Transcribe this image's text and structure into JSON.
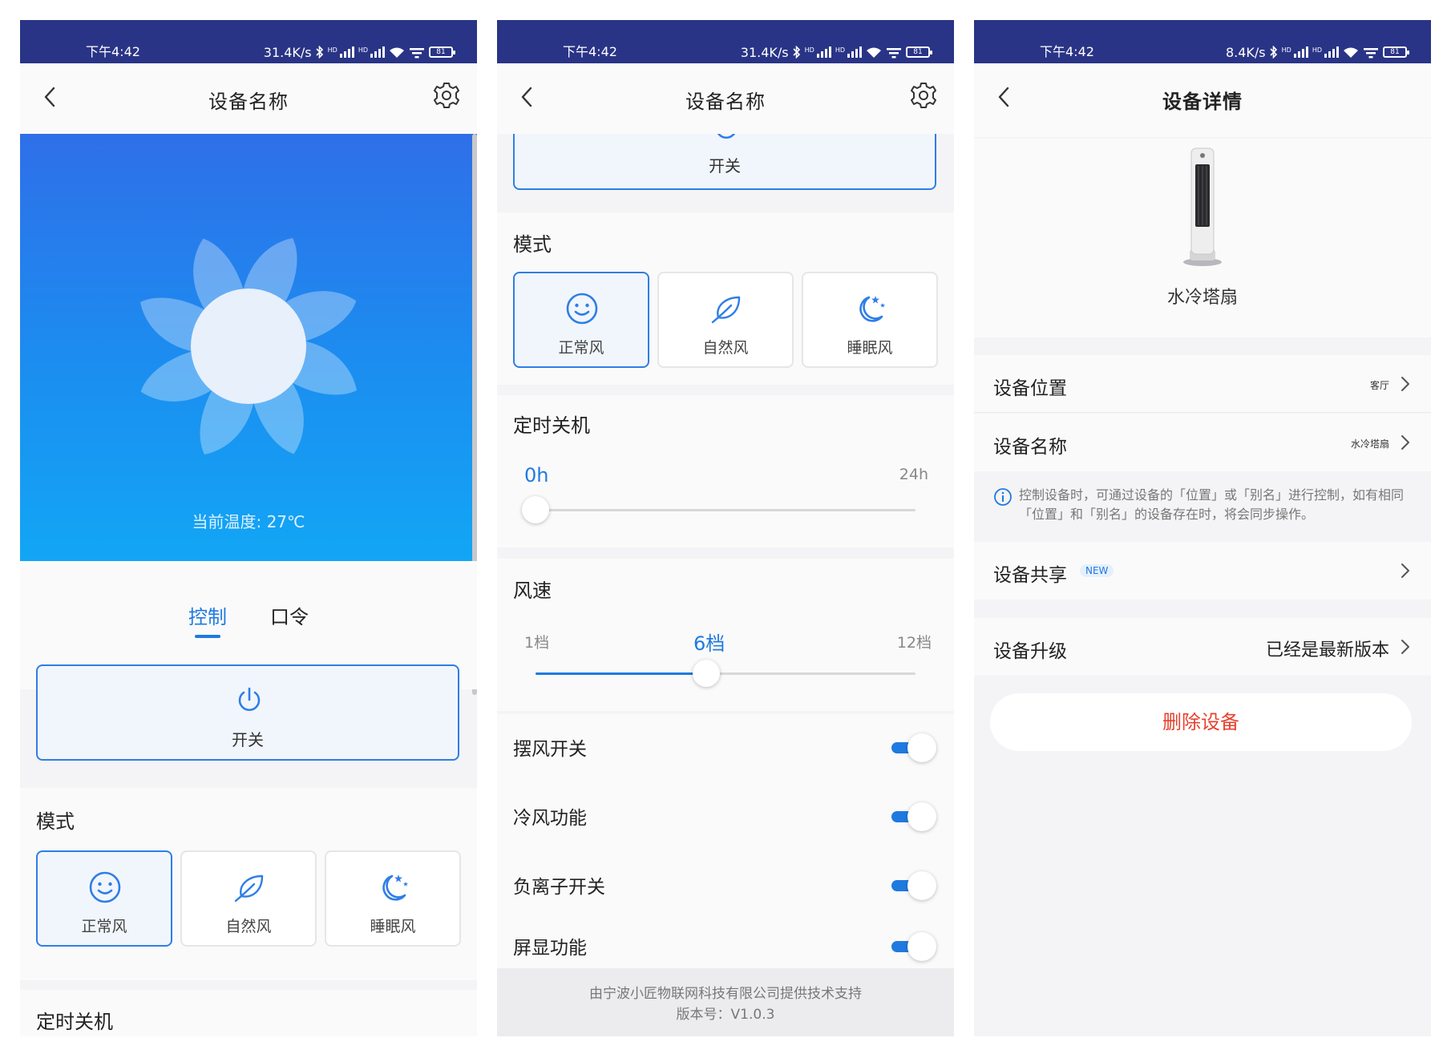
{
  "colors": {
    "status_bar": "#2a3486",
    "accent": "#1f7ae0",
    "delete": "#e8412f"
  },
  "status_bars": [
    {
      "time": "下午4:42",
      "speed": "31.4K/s",
      "battery": "81"
    },
    {
      "time": "下午4:42",
      "speed": "31.4K/s",
      "battery": "81"
    },
    {
      "time": "下午4:42",
      "speed": "8.4K/s",
      "battery": "81"
    }
  ],
  "screen1": {
    "title": "设备名称",
    "temperature": "当前温度: 27℃",
    "tabs": [
      "控制",
      "口令"
    ],
    "active_tab": "控制",
    "power_label": "开关",
    "mode_title": "模式",
    "modes": [
      {
        "label": "正常风",
        "icon": "smile-icon",
        "active": true
      },
      {
        "label": "自然风",
        "icon": "leaf-icon",
        "active": false
      },
      {
        "label": "睡眠风",
        "icon": "moon-stars-icon",
        "active": false
      }
    ],
    "timer_title": "定时关机"
  },
  "screen2": {
    "title": "设备名称",
    "power_label": "开关",
    "mode_title": "模式",
    "modes": [
      {
        "label": "正常风",
        "icon": "smile-icon",
        "active": true
      },
      {
        "label": "自然风",
        "icon": "leaf-icon",
        "active": false
      },
      {
        "label": "睡眠风",
        "icon": "moon-stars-icon",
        "active": false
      }
    ],
    "timer": {
      "title": "定时关机",
      "value": "0h",
      "max_label": "24h",
      "level": 0
    },
    "wind": {
      "title": "风速",
      "min_label": "1档",
      "value": "6档",
      "max_label": "12档",
      "level": 0.45
    },
    "toggles": [
      {
        "label": "摆风开关",
        "on": true
      },
      {
        "label": "冷风功能",
        "on": true
      },
      {
        "label": "负离子开关",
        "on": true
      },
      {
        "label": "屏显功能",
        "on": true
      }
    ],
    "footer": {
      "line1": "由宁波小匠物联网科技有限公司提供技术支持",
      "line2": "版本号：V1.0.3"
    }
  },
  "screen3": {
    "title": "设备详情",
    "device_name": "水冷塔扇",
    "location_label": "设备位置",
    "location_value": "客厅",
    "name_label": "设备名称",
    "name_value": "水冷塔扇",
    "info": "控制设备时，可通过设备的「位置」或「别名」进行控制，如有相同「位置」和「别名」的设备存在时，将会同步操作。",
    "share_label": "设备共享",
    "share_badge": "NEW",
    "upgrade_label": "设备升级",
    "upgrade_value": "已经是最新版本",
    "delete_label": "删除设备"
  }
}
